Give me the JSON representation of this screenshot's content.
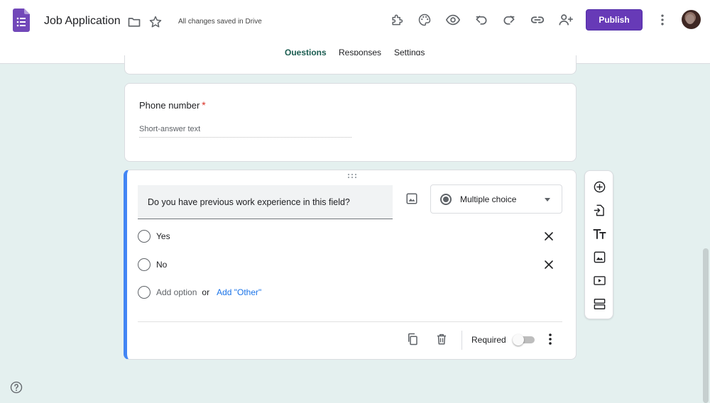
{
  "header": {
    "app_title": "Job Application",
    "saved_status": "All changes saved in Drive",
    "publish_label": "Publish",
    "icons": [
      "forms-logo-icon",
      "folder-icon",
      "star-icon",
      "addon-puzzle-icon",
      "palette-icon",
      "preview-eye-icon",
      "undo-icon",
      "redo-icon",
      "link-icon",
      "add-collaborator-icon",
      "more-vert-icon"
    ]
  },
  "tabs": [
    {
      "label": "Questions",
      "active": true
    },
    {
      "label": "Responses",
      "active": false
    },
    {
      "label": "Settings",
      "active": false
    }
  ],
  "questions": [
    {
      "title": "Phone number",
      "required_mark": "*",
      "placeholder": "Short-answer text"
    },
    {
      "title": "Do you have previous work experience in this field?",
      "type": "Multiple choice",
      "options": [
        "Yes",
        "No"
      ],
      "add_option": "Add option",
      "or": "or",
      "add_other": "Add \"Other\"",
      "required_label": "Required",
      "required_on": false
    }
  ],
  "floating_toolbar": [
    "add-question-icon",
    "import-questions-icon",
    "add-title-icon",
    "add-image-icon",
    "add-video-icon",
    "add-section-icon"
  ],
  "colors": {
    "brand": "#673ab7",
    "accent_tab": "#1a5c50",
    "active_border": "#4285f4",
    "background": "#e4f0ef",
    "link": "#1a73e8",
    "required_star": "#d93025"
  }
}
